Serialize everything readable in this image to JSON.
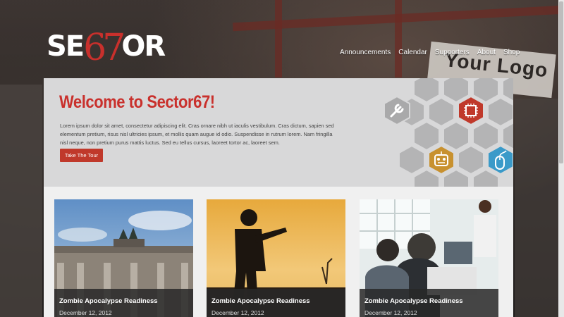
{
  "logo": {
    "text_left": "SE",
    "digits": "67",
    "text_right": "OR"
  },
  "nav": {
    "items": [
      "Announcements",
      "Calendar",
      "Supporters",
      "About",
      "Shop"
    ]
  },
  "background": {
    "sign_text": "Your Logo"
  },
  "hero": {
    "title": "Welcome to Sector67!",
    "body": "Lorem ipsum dolor sit amet, consectetur adipiscing elit. Cras ornare nibh ut iaculis vestibulum. Cras dictum, sapien sed elementum pretium, risus nisl ultricies ipsum, et mollis quam augue id odio. Suspendisse in rutrum lorem. Nam fringilla nisl neque, non pretium purus mattis luctus. Sed eu tellus cursus, laoreet tortor ac, laoreet sem.",
    "button_label": "Take The Tour"
  },
  "cards": [
    {
      "title": "Zombie Apocalypse Readiness",
      "date": "December 12, 2012"
    },
    {
      "title": "Zombie Apocalypse Readiness",
      "date": "December 12, 2012"
    },
    {
      "title": "Zombie Apocalypse Readiness",
      "date": "December 12, 2012"
    }
  ],
  "colors": {
    "accent": "#c9302c",
    "hex_gray": "#a9a9aa",
    "hex_red": "#c0392b",
    "hex_gold": "#c8912f",
    "hex_blue": "#3a9ac9"
  },
  "icons": [
    "wrench-icon",
    "chip-icon",
    "robot-icon",
    "mouse-icon"
  ]
}
